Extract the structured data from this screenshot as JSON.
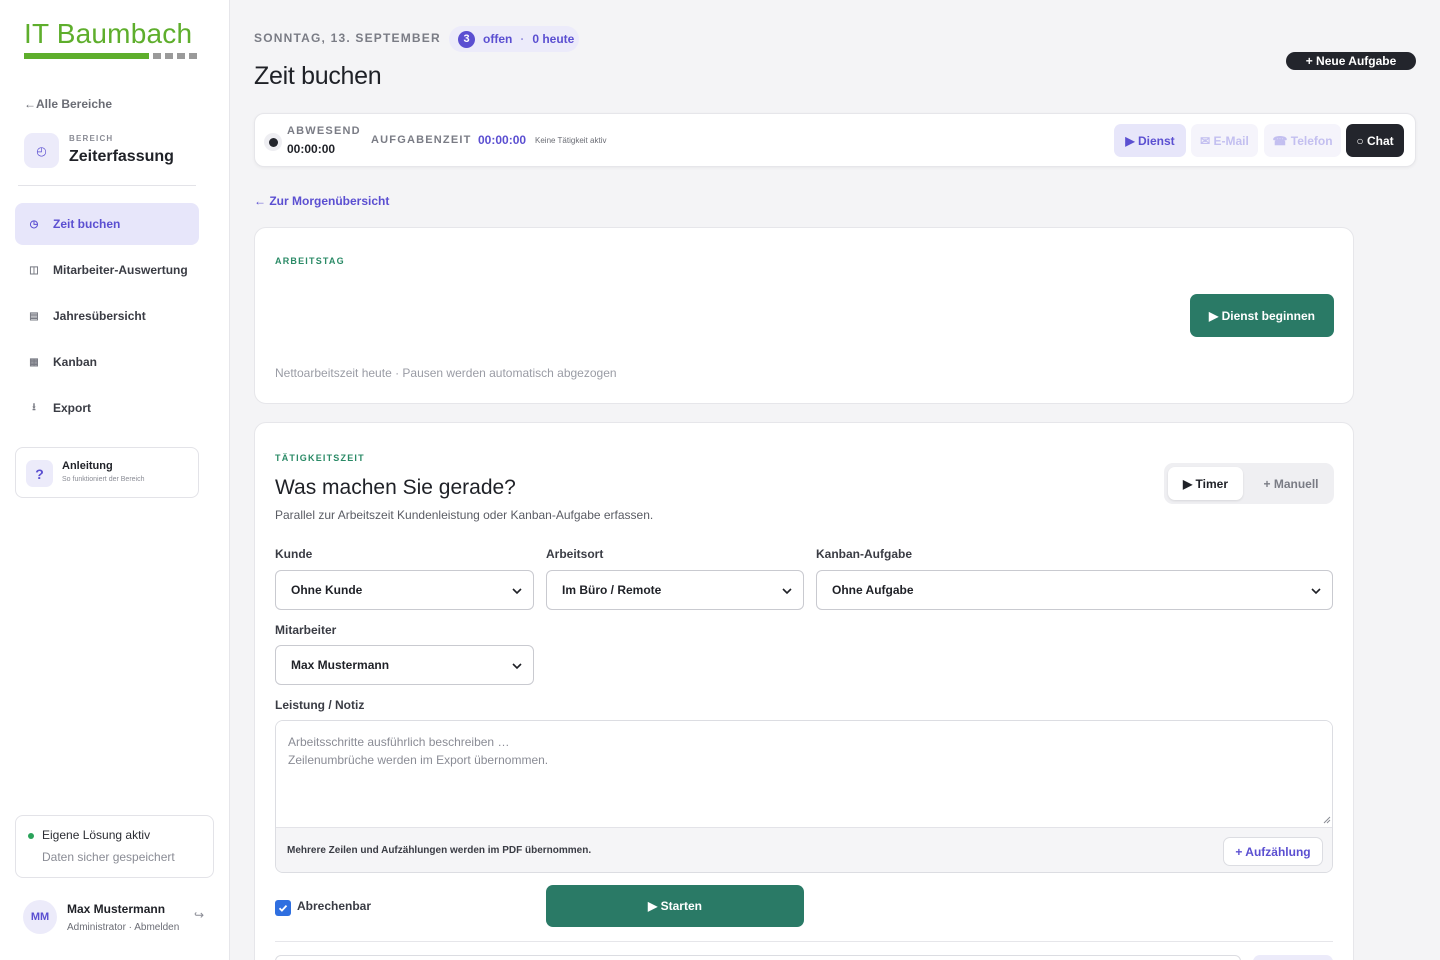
{
  "brand": {
    "name": "IT Baumbach",
    "colors": {
      "brand_green": "#5eae2c",
      "accent": "#5b4fd1",
      "primary_action": "#2a7a66",
      "dark": "#23252c"
    }
  },
  "sidebar": {
    "back_label": "Alle Bereiche",
    "area_label": "BEREICH",
    "area_name": "Zeiterfassung",
    "area_icon": "clock-icon",
    "items": [
      {
        "label": "Zeit buchen",
        "icon": "clock-icon",
        "active": true
      },
      {
        "label": "Mitarbeiter-Auswertung",
        "icon": "columns-icon",
        "active": false
      },
      {
        "label": "Jahresübersicht",
        "icon": "table-icon",
        "active": false
      },
      {
        "label": "Kanban",
        "icon": "grid-icon",
        "active": false
      },
      {
        "label": "Export",
        "icon": "download-icon",
        "active": false
      }
    ],
    "guide": {
      "title": "Anleitung",
      "subtitle": "So funktioniert der Bereich"
    },
    "status": {
      "title": "Eigene Lösung aktiv",
      "subtitle": "Daten sicher gespeichert"
    },
    "user": {
      "initials": "MM",
      "name": "Max Mustermann",
      "role": "Administrator · Abmelden"
    }
  },
  "header": {
    "date": "SONNTAG, 13. SEPTEMBER",
    "open_count": "3",
    "open_label": "offen",
    "today_label": "0 heute",
    "title": "Zeit buchen",
    "new_task_label": "+ Neue Aufgabe"
  },
  "topbar": {
    "absent_label": "ABWESEND",
    "absent_time": "00:00:00",
    "task_label": "AUFGABENZEIT",
    "task_time": "00:00:00",
    "task_status": "Keine Tätigkeit aktiv",
    "buttons": {
      "dienst": "▶ Dienst",
      "email": "✉ E-Mail",
      "telefon": "☎ Telefon",
      "chat": "○ Chat"
    }
  },
  "back_morning": "Zur Morgenübersicht",
  "workday": {
    "label": "ARBEITSTAG",
    "start_label": "▶ Dienst beginnen",
    "note": "Nettoarbeitszeit heute · Pausen werden automatisch abgezogen"
  },
  "activity": {
    "label": "TÄTIGKEITSZEIT",
    "title": "Was machen Sie gerade?",
    "subtitle": "Parallel zur Arbeitszeit Kundenleistung oder Kanban-Aufgabe erfassen.",
    "mode_timer": "▶ Timer",
    "mode_manual": "+ Manuell",
    "fields": {
      "customer": {
        "label": "Kunde",
        "value": "Ohne Kunde"
      },
      "location": {
        "label": "Arbeitsort",
        "value": "Im Büro / Remote"
      },
      "kanban": {
        "label": "Kanban-Aufgabe",
        "value": "Ohne Aufgabe"
      },
      "employee": {
        "label": "Mitarbeiter",
        "value": "Max Mustermann"
      }
    },
    "note": {
      "label": "Leistung / Notiz",
      "placeholder_line1": "Arbeitsschritte ausführlich beschreiben …",
      "placeholder_line2": "Zeilenumbrüche werden im Export übernommen.",
      "hint": "Mehrere Zeilen und Aufzählungen werden im PDF übernommen.",
      "list_button": "+ Aufzählung"
    },
    "billable_label": "Abrechenbar",
    "billable_checked": true,
    "start_label": "▶ Starten"
  }
}
